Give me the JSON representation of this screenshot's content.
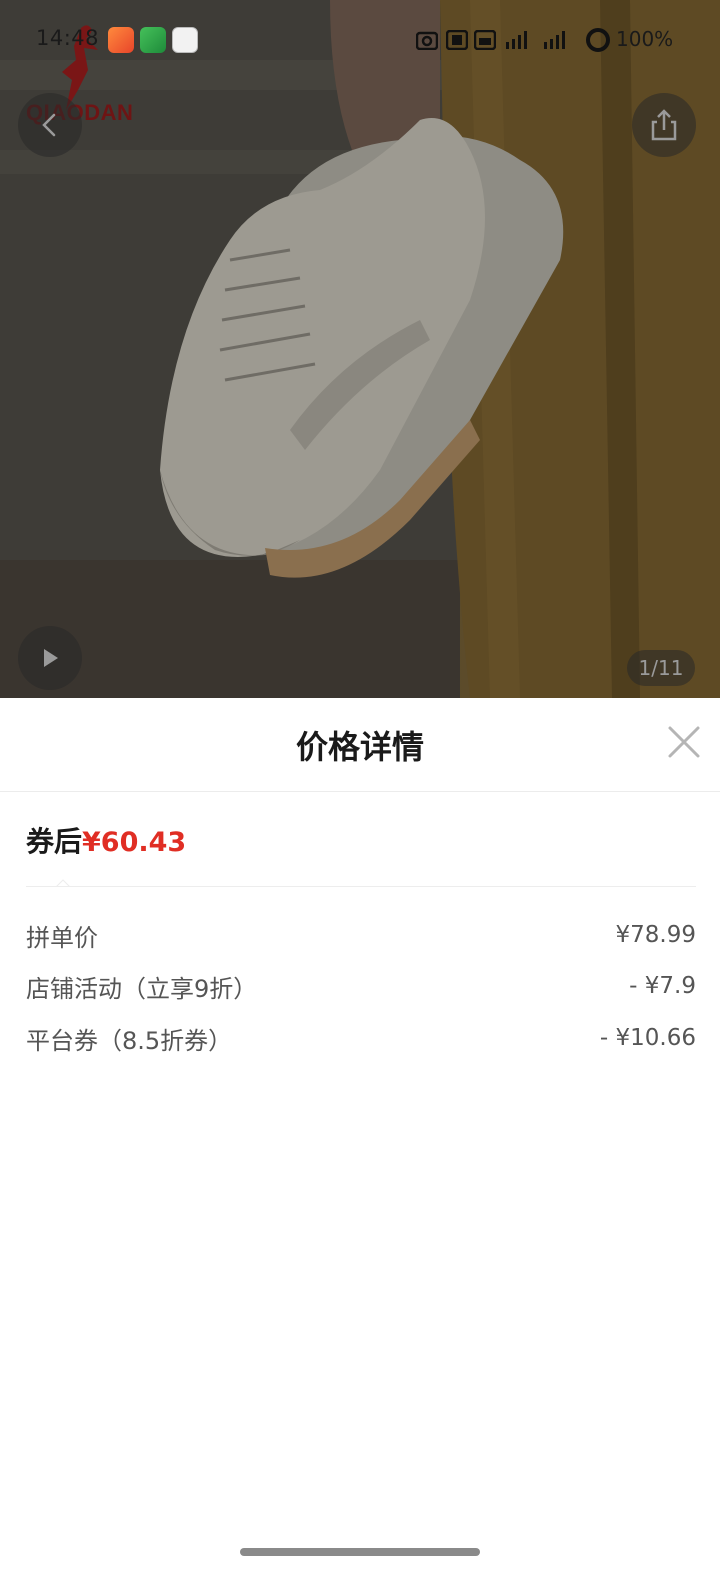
{
  "status_bar": {
    "time": "14:48",
    "battery": "100%"
  },
  "hero": {
    "brand": "QIAODAN",
    "counter": "1/11"
  },
  "sheet": {
    "title": "价格详情",
    "final_label": "券后",
    "final_price": "¥60.43",
    "rows": [
      {
        "label": "拼单价",
        "value": "¥78.99"
      },
      {
        "label": "店铺活动（立享9折）",
        "value": "- ¥7.9"
      },
      {
        "label": "平台券（8.5折券）",
        "value": "- ¥10.66"
      }
    ]
  },
  "colors": {
    "accent_red": "#e02e24",
    "text_primary": "#1a1a1a",
    "text_secondary": "#555555"
  }
}
